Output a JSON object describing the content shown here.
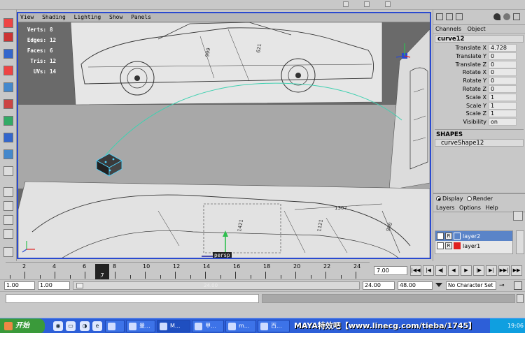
{
  "viewport": {
    "menu": [
      "View",
      "Shading",
      "Lighting",
      "Show",
      "Panels"
    ],
    "hud": [
      {
        "label": "Verts:",
        "value": "8"
      },
      {
        "label": "Edges:",
        "value": "12"
      },
      {
        "label": "Faces:",
        "value": "6"
      },
      {
        "label": "Tris:",
        "value": "12"
      },
      {
        "label": "UVs:",
        "value": "14"
      }
    ],
    "camera_label": "persp",
    "drawing_dimensions": [
      "999",
      "621",
      "1307",
      "1421",
      "1121",
      "990"
    ]
  },
  "channel_box": {
    "tabs": [
      "Channels",
      "Object"
    ],
    "object_name": "curve12",
    "attributes": [
      {
        "name": "Translate X",
        "value": "4.728"
      },
      {
        "name": "Translate Y",
        "value": "0"
      },
      {
        "name": "Translate Z",
        "value": "0"
      },
      {
        "name": "Rotate X",
        "value": "0"
      },
      {
        "name": "Rotate Y",
        "value": "0"
      },
      {
        "name": "Rotate Z",
        "value": "0"
      },
      {
        "name": "Scale X",
        "value": "1"
      },
      {
        "name": "Scale Y",
        "value": "1"
      },
      {
        "name": "Scale Z",
        "value": "1"
      },
      {
        "name": "Visibility",
        "value": "on"
      }
    ],
    "shapes_header": "SHAPES",
    "shape_name": "curveShape12"
  },
  "layer_editor": {
    "display_label": "Display",
    "render_label": "Render",
    "menu": [
      "Layers",
      "Options",
      "Help"
    ],
    "layers": [
      {
        "name": "layer2",
        "visibility": "",
        "render": "R",
        "color": "#5a84c8",
        "selected": true
      },
      {
        "name": "layer1",
        "visibility": "",
        "render": "R",
        "color": "#e02020",
        "selected": false
      }
    ]
  },
  "timeline": {
    "ticks": [
      "2",
      "4",
      "6",
      "8",
      "10",
      "12",
      "14",
      "16",
      "18",
      "20",
      "22",
      "24"
    ],
    "current_frame": "7",
    "frame_field": "7.00"
  },
  "range": {
    "start": "1.00",
    "inner_start": "1.00",
    "slider_ghost": "24.00",
    "end": "24.00",
    "outer_end": "48.00",
    "character_set": "No Character Set"
  },
  "taskbar": {
    "start_label": "开始",
    "tasks": [
      "量...",
      "M...",
      "甲...",
      "m...",
      "百..."
    ],
    "watermark": "MAYA特效吧【www.linecg.com/tieba/1745】",
    "clock": "19:06"
  },
  "colors": {
    "viewport_border": "#2a4ad0",
    "taskbar": "#2d5fd8",
    "curve": "#40d0b0",
    "selected_layer": "#5a84c8"
  }
}
